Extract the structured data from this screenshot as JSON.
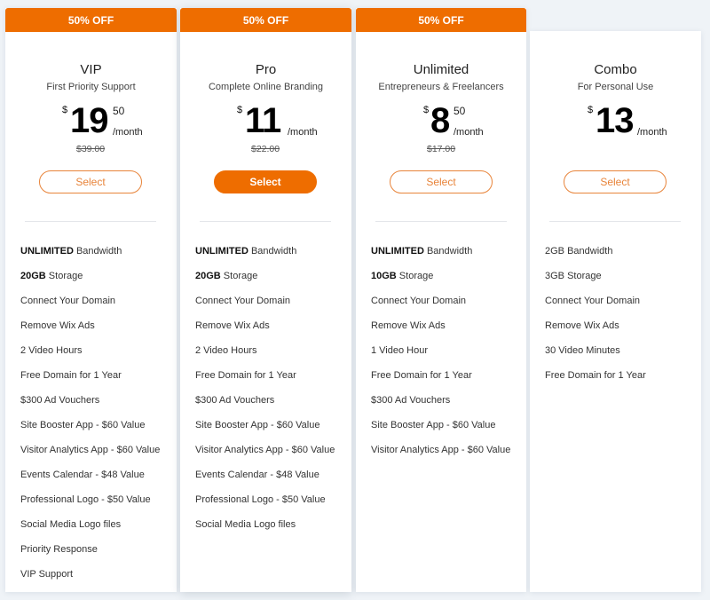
{
  "plans": [
    {
      "badge": "50% OFF",
      "name": "VIP",
      "tagline": "First Priority Support",
      "currency": "$",
      "price_whole": "19",
      "price_cents": "50",
      "period": "/month",
      "original_price": "$39.00",
      "select_label": "Select",
      "features": [
        {
          "bold": "UNLIMITED",
          "text": " Bandwidth"
        },
        {
          "bold": "20GB",
          "text": " Storage"
        },
        {
          "bold": "",
          "text": "Connect Your Domain"
        },
        {
          "bold": "",
          "text": "Remove Wix Ads"
        },
        {
          "bold": "",
          "text": "2 Video Hours"
        },
        {
          "bold": "",
          "text": "Free Domain for 1 Year"
        },
        {
          "bold": "",
          "text": "$300 Ad Vouchers"
        },
        {
          "bold": "",
          "text": "Site Booster App - $60 Value"
        },
        {
          "bold": "",
          "text": "Visitor Analytics App - $60 Value"
        },
        {
          "bold": "",
          "text": "Events Calendar - $48 Value"
        },
        {
          "bold": "",
          "text": "Professional Logo - $50 Value"
        },
        {
          "bold": "",
          "text": "Social Media Logo files"
        },
        {
          "bold": "",
          "text": "Priority Response"
        },
        {
          "bold": "",
          "text": "VIP Support"
        }
      ]
    },
    {
      "badge": "50% OFF",
      "name": "Pro",
      "tagline": "Complete Online Branding",
      "currency": "$",
      "price_whole": "11",
      "price_cents": "",
      "period": "/month",
      "original_price": "$22.00",
      "select_label": "Select",
      "features": [
        {
          "bold": "UNLIMITED",
          "text": " Bandwidth"
        },
        {
          "bold": "20GB",
          "text": " Storage"
        },
        {
          "bold": "",
          "text": "Connect Your Domain"
        },
        {
          "bold": "",
          "text": "Remove Wix Ads"
        },
        {
          "bold": "",
          "text": "2 Video Hours"
        },
        {
          "bold": "",
          "text": "Free Domain for 1 Year"
        },
        {
          "bold": "",
          "text": "$300 Ad Vouchers"
        },
        {
          "bold": "",
          "text": "Site Booster App - $60 Value"
        },
        {
          "bold": "",
          "text": "Visitor Analytics App - $60 Value"
        },
        {
          "bold": "",
          "text": "Events Calendar - $48 Value"
        },
        {
          "bold": "",
          "text": "Professional Logo - $50 Value"
        },
        {
          "bold": "",
          "text": "Social Media Logo files"
        }
      ]
    },
    {
      "badge": "50% OFF",
      "name": "Unlimited",
      "tagline": "Entrepreneurs & Freelancers",
      "currency": "$",
      "price_whole": "8",
      "price_cents": "50",
      "period": "/month",
      "original_price": "$17.00",
      "select_label": "Select",
      "features": [
        {
          "bold": "UNLIMITED",
          "text": " Bandwidth"
        },
        {
          "bold": "10GB",
          "text": " Storage"
        },
        {
          "bold": "",
          "text": "Connect Your Domain"
        },
        {
          "bold": "",
          "text": "Remove Wix Ads"
        },
        {
          "bold": "",
          "text": "1 Video Hour"
        },
        {
          "bold": "",
          "text": "Free Domain for 1 Year"
        },
        {
          "bold": "",
          "text": "$300 Ad Vouchers"
        },
        {
          "bold": "",
          "text": "Site Booster App - $60 Value"
        },
        {
          "bold": "",
          "text": "Visitor Analytics App - $60 Value"
        }
      ]
    },
    {
      "badge": "",
      "name": "Combo",
      "tagline": "For Personal Use",
      "currency": "$",
      "price_whole": "13",
      "price_cents": "",
      "period": "/month",
      "original_price": "",
      "select_label": "Select",
      "features": [
        {
          "bold": "",
          "text": "2GB Bandwidth"
        },
        {
          "bold": "",
          "text": "3GB Storage"
        },
        {
          "bold": "",
          "text": "Connect Your Domain"
        },
        {
          "bold": "",
          "text": "Remove Wix Ads"
        },
        {
          "bold": "",
          "text": "30 Video Minutes"
        },
        {
          "bold": "",
          "text": "Free Domain for 1 Year"
        }
      ]
    }
  ],
  "selected_plan_index": 1,
  "colors": {
    "accent": "#ee6d00",
    "outline": "#e8843a",
    "background": "#eff3f7"
  }
}
